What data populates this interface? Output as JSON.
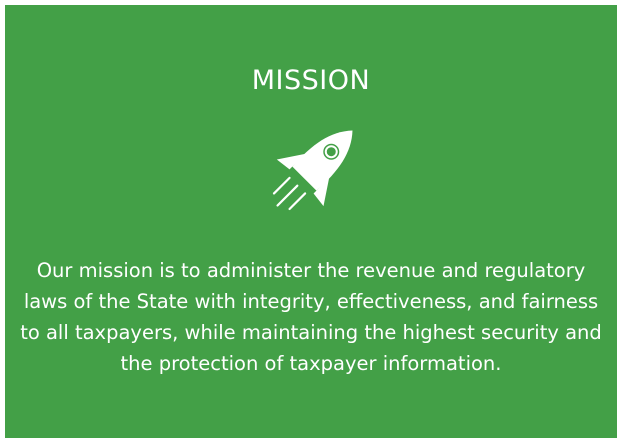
{
  "card": {
    "background": "#43a047",
    "title": "MISSION",
    "icon": "rocket-icon",
    "text": "Our mission is to administer the revenue and regulatory laws of the State with integrity, effectiveness, and fairness to all taxpayers, while maintaining the highest security and the protection of taxpayer information."
  }
}
